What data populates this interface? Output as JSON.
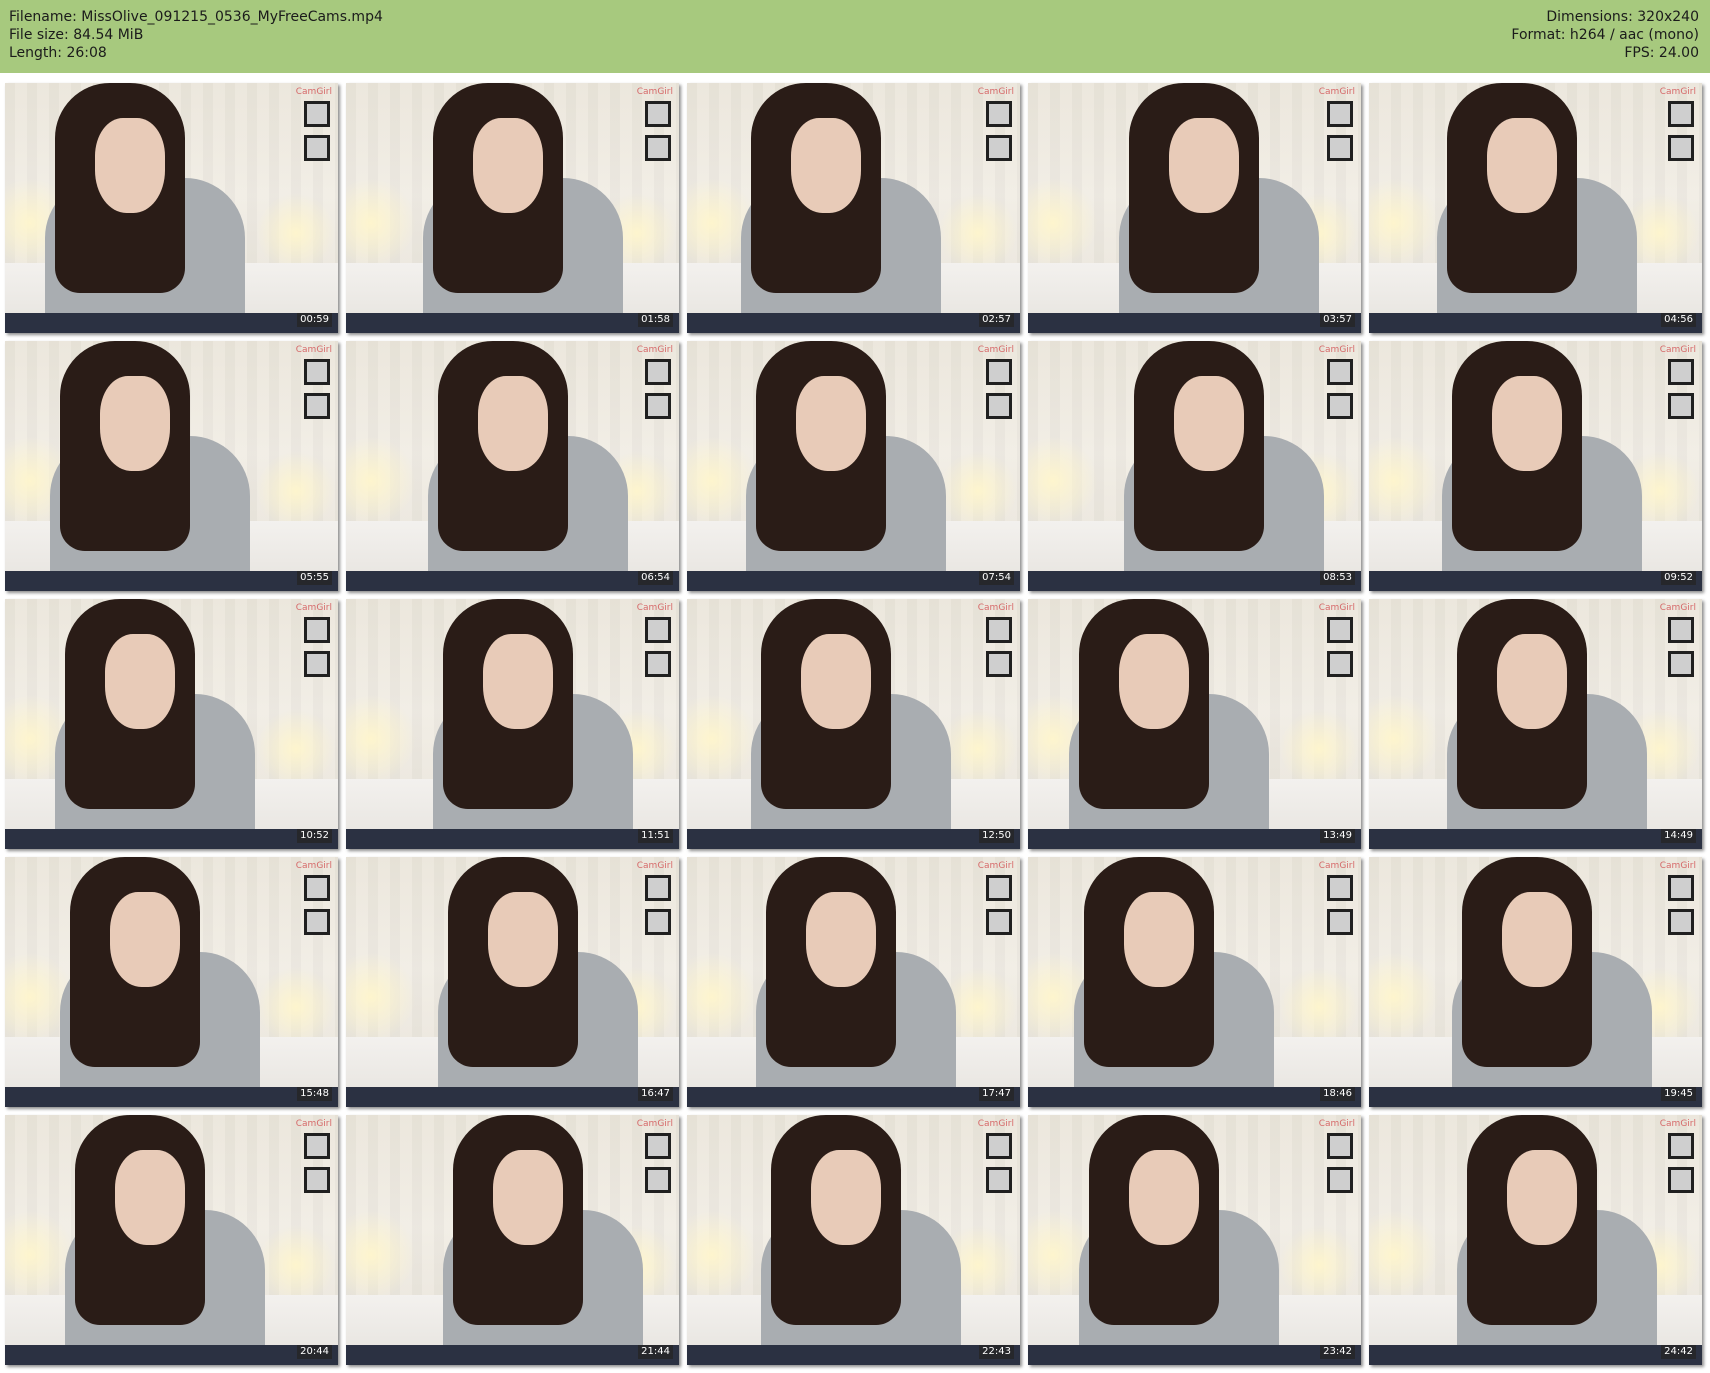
{
  "meta": {
    "filename": "Filename: MissOlive_091215_0536_MyFreeCams.mp4",
    "filesize": "File size: 84.54 MiB",
    "length": "Length: 26:08",
    "dimensions": "Dimensions: 320x240",
    "format": "Format: h264 / aac (mono)",
    "fps": "FPS: 24.00"
  },
  "watermark": "CamGirl",
  "timestamps": [
    "00:59",
    "01:58",
    "02:57",
    "03:57",
    "04:56",
    "05:55",
    "06:54",
    "07:54",
    "08:53",
    "09:52",
    "10:52",
    "11:51",
    "12:50",
    "13:49",
    "14:49",
    "15:48",
    "16:47",
    "17:47",
    "18:46",
    "19:45",
    "20:44",
    "21:44",
    "22:43",
    "23:42",
    "24:42"
  ],
  "colors": {
    "header_bg": "#a7c97e"
  }
}
